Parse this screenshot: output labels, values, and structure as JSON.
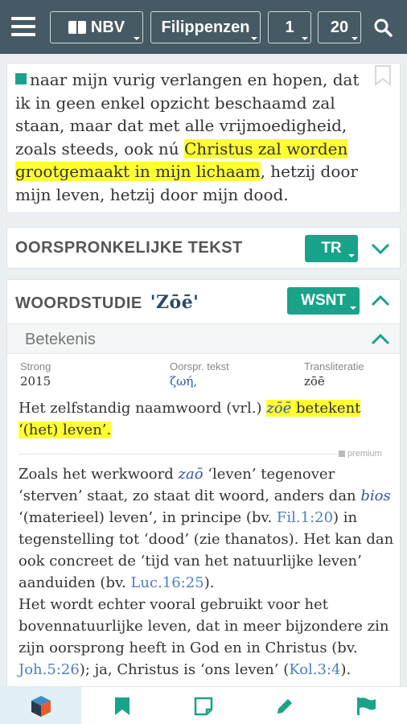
{
  "topbar": {
    "translation": "NBV",
    "book": "Filippenzen",
    "chapter": "1",
    "verse": "20"
  },
  "verse": {
    "text_before": "naar mijn vurig verlangen en hopen, dat ik in geen enkel opzicht beschaamd zal staan, maar dat met alle vrijmoedigheid, zoals steeds, ook nú ",
    "text_highlight": "Christus zal worden grootgemaakt in mijn lichaam",
    "text_after": ", hetzij door mijn leven, hetzij door mijn dood."
  },
  "original_text": {
    "title": "OORSPRONKELIJKE TEKST",
    "badge": "TR"
  },
  "wordstudy": {
    "title": "WOORDSTUDIE",
    "word": "'Zōē'",
    "badge": "WSNT",
    "section": "Betekenis",
    "strong_label": "Strong",
    "strong_value": "2015",
    "orig_label": "Oorspr. tekst",
    "orig_value": "ζωή,",
    "translit_label": "Transliteratie",
    "translit_value": "zōē",
    "meaning_before": "Het zelfstandig naamwoord (vrl.) ",
    "meaning_word": "zōē",
    "meaning_hl": " betekent ‘(het) leven’.",
    "premium": "premium",
    "p1": "Zoals het werkwoord ",
    "p1_word": "zaō",
    "p2": " ‘leven’ tegenover ‘sterven’ staat, zo staat dit woord, anders dan ",
    "p2_word": "bios",
    "p3": " ‘(materieel) leven’, in principe (bv. ",
    "ref1": "Fil.1:20",
    "p4": ") in tegenstelling tot ‘dood’ (zie thanatos). Het kan dan ook concreet de ‘tijd van het natuurlijke leven’ aanduiden (bv. ",
    "ref2": "Luc.16:25",
    "p5": ").",
    "p6": "Het wordt echter vooral gebruikt voor het bovennatuurlijke leven, dat in meer bijzondere zin zijn oorsprong heeft in God en in Christus (bv. ",
    "ref3": "Joh.5:26",
    "p7": "); ja, Christus is ‘ons leven’ (",
    "ref4": "Kol.3:4",
    "p8": ")."
  },
  "colors": {
    "appbar": "#455a64",
    "accent": "#19a389",
    "highlight": "#ffff33",
    "link": "#4a7fc1"
  }
}
